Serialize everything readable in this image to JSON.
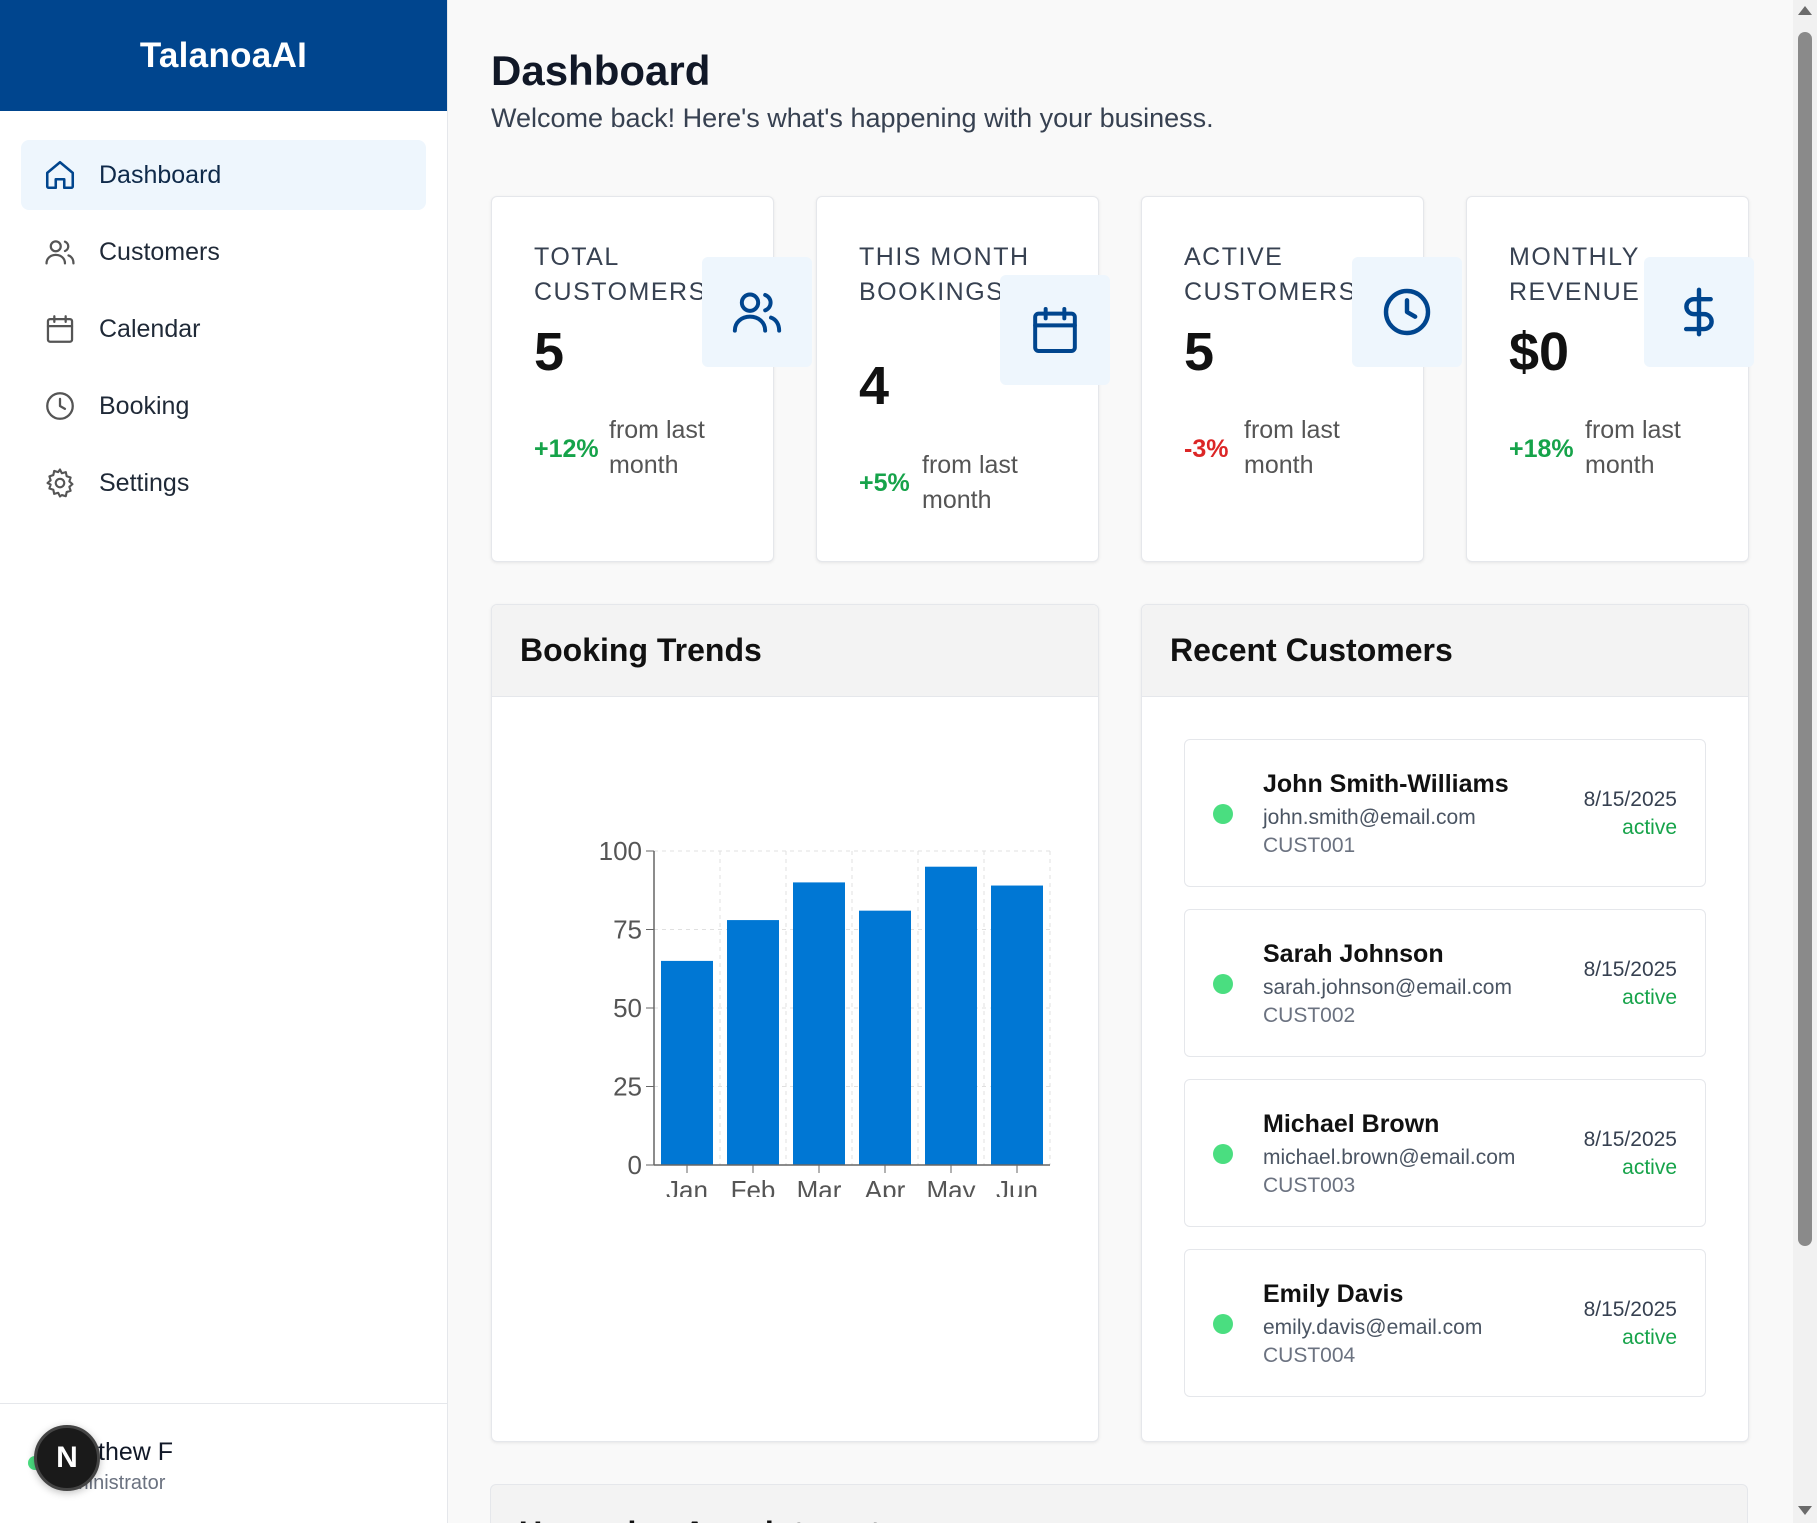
{
  "app": {
    "brand": "TalanoaAI"
  },
  "sidebar": {
    "items": [
      {
        "label": "Dashboard",
        "icon": "home-icon",
        "active": true
      },
      {
        "label": "Customers",
        "icon": "users-icon",
        "active": false
      },
      {
        "label": "Calendar",
        "icon": "calendar-icon",
        "active": false
      },
      {
        "label": "Booking",
        "icon": "clock-icon",
        "active": false
      },
      {
        "label": "Settings",
        "icon": "gear-icon",
        "active": false
      }
    ],
    "user": {
      "avatar_letter": "N",
      "name": "thew F",
      "role": "ministrator"
    }
  },
  "header": {
    "title": "Dashboard",
    "subtitle": "Welcome back! Here's what's happening with your business."
  },
  "stats": [
    {
      "label": "TOTAL CUSTOMERS",
      "value": "5",
      "change": "+12%",
      "note": "from last month",
      "trend": "up",
      "icon": "users-icon"
    },
    {
      "label": "THIS MONTH BOOKINGS",
      "value": "4",
      "change": "+5%",
      "note": "from last month",
      "trend": "up",
      "icon": "calendar-icon"
    },
    {
      "label": "ACTIVE CUSTOMERS",
      "value": "5",
      "change": "-3%",
      "note": "from last month",
      "trend": "down",
      "icon": "clock-icon"
    },
    {
      "label": "MONTHLY REVENUE",
      "value": "$0",
      "change": "+18%",
      "note": "from last month",
      "trend": "up",
      "icon": "dollar-icon"
    }
  ],
  "booking_trends": {
    "title": "Booking Trends"
  },
  "chart_data": {
    "type": "bar",
    "title": "Booking Trends",
    "categories": [
      "Jan",
      "Feb",
      "Mar",
      "Apr",
      "May",
      "Jun"
    ],
    "values": [
      65,
      78,
      90,
      81,
      95,
      89
    ],
    "ylim": [
      0,
      100
    ],
    "yticks": [
      0,
      25,
      50,
      75,
      100
    ],
    "xlabel": "",
    "ylabel": "",
    "grid": true,
    "color": "#0077d4"
  },
  "recent_customers": {
    "title": "Recent Customers",
    "items": [
      {
        "name": "John Smith-Williams",
        "email": "john.smith@email.com",
        "id": "CUST001",
        "date": "8/15/2025",
        "status": "active"
      },
      {
        "name": "Sarah Johnson",
        "email": "sarah.johnson@email.com",
        "id": "CUST002",
        "date": "8/15/2025",
        "status": "active"
      },
      {
        "name": "Michael Brown",
        "email": "michael.brown@email.com",
        "id": "CUST003",
        "date": "8/15/2025",
        "status": "active"
      },
      {
        "name": "Emily Davis",
        "email": "emily.davis@email.com",
        "id": "CUST004",
        "date": "8/15/2025",
        "status": "active"
      }
    ]
  },
  "upcoming": {
    "title": "Upcoming Appointments"
  },
  "colors": {
    "brand": "#00458e",
    "accent": "#0077d4",
    "positive": "#16a34a",
    "negative": "#dc2626",
    "online": "#4ade80"
  }
}
